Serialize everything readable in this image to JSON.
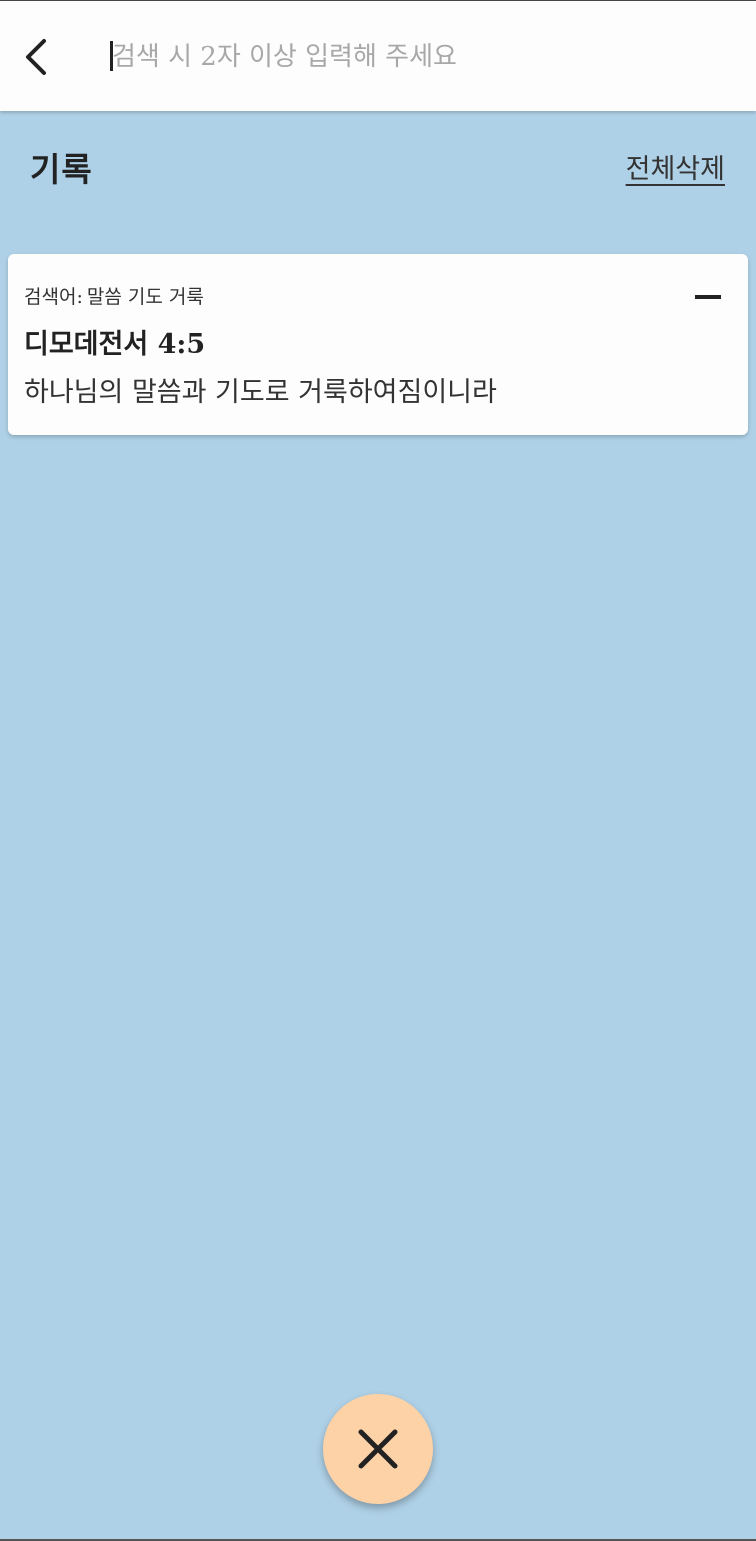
{
  "search": {
    "placeholder": "검색 시 2자 이상 입력해 주세요",
    "value": ""
  },
  "header": {
    "back_icon": "chevron-left-icon"
  },
  "history": {
    "title": "기록",
    "clear_all_label": "전체삭제",
    "items": [
      {
        "query_label": "검색어:",
        "query": "말씀 기도 거룩",
        "reference": "디모데전서 4:5",
        "text": "하나님의 말씀과 기도로 거룩하여짐이니라",
        "remove_icon": "minus-icon"
      }
    ]
  },
  "fab": {
    "icon": "close-icon",
    "color": "#fdd2a6"
  },
  "colors": {
    "background": "#afd1e7",
    "surface": "#fdfdfd",
    "text": "#222222"
  }
}
